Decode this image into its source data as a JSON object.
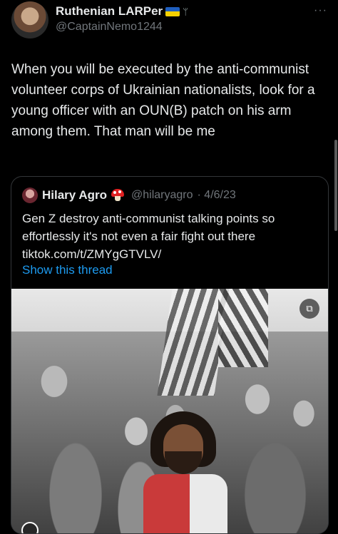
{
  "tweet": {
    "author": {
      "display_name": "Ruthenian LARPer",
      "handle": "@CaptainNemo1244",
      "badges": [
        "ukraine-flag-icon",
        "trident-icon"
      ]
    },
    "more_menu": "···",
    "text": "When you will be executed by the anti-communist volunteer corps of Ukrainian nationalists, look for a young officer with an OUN(B) patch on his arm among them. That man will be me"
  },
  "quote": {
    "author": {
      "display_name": "Hilary Agro",
      "handle": "@hilaryagro",
      "date": "· 4/6/23",
      "badge": "mushroom-icon"
    },
    "text": "Gen Z destroy anti-communist talking points so effortlessly it's not even a fair fight out there",
    "link_text": "tiktok.com/t/ZMYgGTVLV/",
    "show_thread": "Show this thread",
    "media": {
      "description_icon": "sensitive-media-icon"
    }
  },
  "colors": {
    "background": "#000000",
    "text": "#e7e9ea",
    "secondary": "#71767b",
    "link": "#1d9bf0",
    "border": "#333639"
  }
}
